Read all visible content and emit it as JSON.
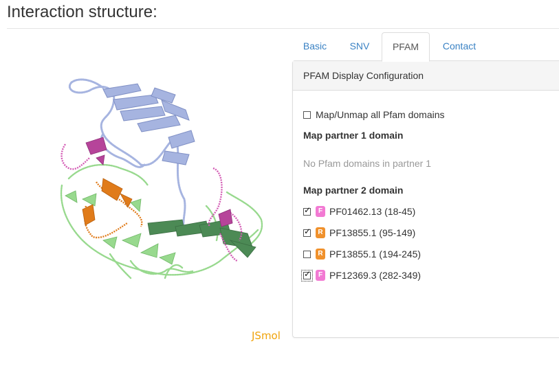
{
  "page": {
    "title": "Interaction structure:"
  },
  "viewer": {
    "label": "JSmol",
    "label_color": "#f0a30a"
  },
  "tabs": [
    {
      "label": "Basic",
      "active": false
    },
    {
      "label": "SNV",
      "active": false
    },
    {
      "label": "PFAM",
      "active": true
    },
    {
      "label": "Contact",
      "active": false
    }
  ],
  "panel": {
    "heading": "PFAM Display Configuration",
    "map_all_label": "Map/Unmap all Pfam domains",
    "map_all_checked": false,
    "partner1_heading": "Map partner 1 domain",
    "partner1_empty": "No Pfam domains in partner 1",
    "partner2_heading": "Map partner 2 domain",
    "partner2_domains": [
      {
        "badge": "F",
        "label": "PF01462.13 (18-45)",
        "checked": true,
        "color": "#f27ad3"
      },
      {
        "badge": "R",
        "label": "PF13855.1 (95-149)",
        "checked": true,
        "color": "#f0912c"
      },
      {
        "badge": "R",
        "label": "PF13855.1 (194-245)",
        "checked": false,
        "color": "#f0912c"
      },
      {
        "badge": "F",
        "label": "PF12369.3 (282-349)",
        "checked": true,
        "color": "#f27ad3"
      }
    ]
  },
  "colors": {
    "link": "#3a82c4",
    "protein_chain_a": "#a6b4e0",
    "protein_chain_b": "#98d98e",
    "protein_dark_green": "#4c8a55",
    "protein_orange": "#e07b1a",
    "protein_magenta": "#d35bb4"
  }
}
